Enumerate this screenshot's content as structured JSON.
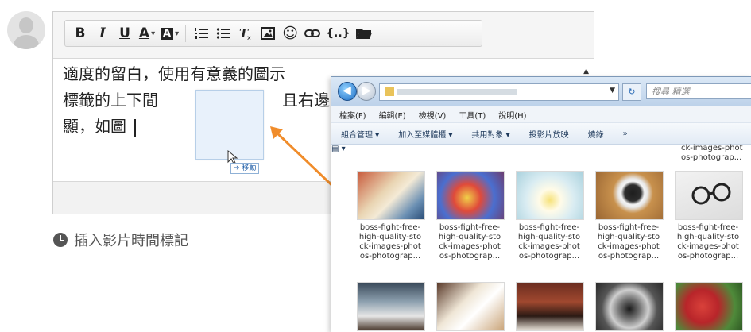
{
  "toolbar": {
    "bold": "B",
    "italic": "I",
    "underline": "U",
    "font_color": "A",
    "bg_color": "A",
    "caret": "▾",
    "emoji": "☺",
    "code": "{..}"
  },
  "editor": {
    "line1": "適度的留白，使用有意義的圖示",
    "line2a": "標籤的上下間",
    "line2b": "且右邊",
    "line3": "顯，如圖"
  },
  "drag": {
    "move_label": "➔ 移動"
  },
  "timestamp": {
    "label": "插入影片時間標記"
  },
  "explorer": {
    "search_placeholder": "搜尋 精選",
    "menu": [
      "檔案(F)",
      "編輯(E)",
      "檢視(V)",
      "工具(T)",
      "說明(H)"
    ],
    "commands": [
      "組合管理 ▾",
      "加入至媒體櫃 ▾",
      "共用對象 ▾",
      "投影片放映",
      "燒錄",
      "»"
    ],
    "partial_label": "ck-images-phot os-photograp...",
    "file_caption": "boss-fight-free-high-quality-stock-images-photos-photograp...",
    "captions": [
      "boss-fight-free-\nhigh-quality-sto\nck-images-phot\nos-photograp...",
      "boss-fight-free-\nhigh-quality-sto\nck-images-phot\nos-photograp...",
      "boss-fight-free-\nhigh-quality-sto\nck-images-phot\nos-photograp...",
      "boss-fight-free-\nhigh-quality-sto\nck-images-phot\nos-photograp...",
      "boss-fight-free-\nhigh-quality-sto\nck-images-phot\nos-photograp..."
    ]
  }
}
